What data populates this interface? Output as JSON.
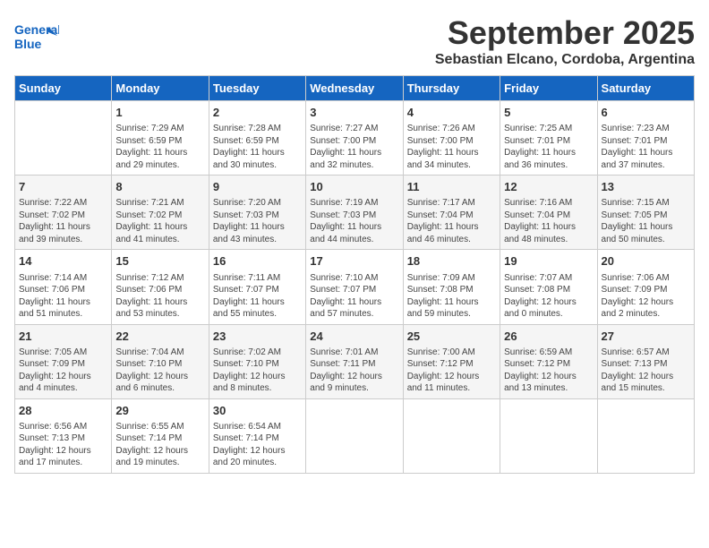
{
  "header": {
    "logo_line1": "General",
    "logo_line2": "Blue",
    "month": "September 2025",
    "location": "Sebastian Elcano, Cordoba, Argentina"
  },
  "days_of_week": [
    "Sunday",
    "Monday",
    "Tuesday",
    "Wednesday",
    "Thursday",
    "Friday",
    "Saturday"
  ],
  "weeks": [
    [
      {
        "day": "",
        "info": ""
      },
      {
        "day": "1",
        "info": "Sunrise: 7:29 AM\nSunset: 6:59 PM\nDaylight: 11 hours\nand 29 minutes."
      },
      {
        "day": "2",
        "info": "Sunrise: 7:28 AM\nSunset: 6:59 PM\nDaylight: 11 hours\nand 30 minutes."
      },
      {
        "day": "3",
        "info": "Sunrise: 7:27 AM\nSunset: 7:00 PM\nDaylight: 11 hours\nand 32 minutes."
      },
      {
        "day": "4",
        "info": "Sunrise: 7:26 AM\nSunset: 7:00 PM\nDaylight: 11 hours\nand 34 minutes."
      },
      {
        "day": "5",
        "info": "Sunrise: 7:25 AM\nSunset: 7:01 PM\nDaylight: 11 hours\nand 36 minutes."
      },
      {
        "day": "6",
        "info": "Sunrise: 7:23 AM\nSunset: 7:01 PM\nDaylight: 11 hours\nand 37 minutes."
      }
    ],
    [
      {
        "day": "7",
        "info": "Sunrise: 7:22 AM\nSunset: 7:02 PM\nDaylight: 11 hours\nand 39 minutes."
      },
      {
        "day": "8",
        "info": "Sunrise: 7:21 AM\nSunset: 7:02 PM\nDaylight: 11 hours\nand 41 minutes."
      },
      {
        "day": "9",
        "info": "Sunrise: 7:20 AM\nSunset: 7:03 PM\nDaylight: 11 hours\nand 43 minutes."
      },
      {
        "day": "10",
        "info": "Sunrise: 7:19 AM\nSunset: 7:03 PM\nDaylight: 11 hours\nand 44 minutes."
      },
      {
        "day": "11",
        "info": "Sunrise: 7:17 AM\nSunset: 7:04 PM\nDaylight: 11 hours\nand 46 minutes."
      },
      {
        "day": "12",
        "info": "Sunrise: 7:16 AM\nSunset: 7:04 PM\nDaylight: 11 hours\nand 48 minutes."
      },
      {
        "day": "13",
        "info": "Sunrise: 7:15 AM\nSunset: 7:05 PM\nDaylight: 11 hours\nand 50 minutes."
      }
    ],
    [
      {
        "day": "14",
        "info": "Sunrise: 7:14 AM\nSunset: 7:06 PM\nDaylight: 11 hours\nand 51 minutes."
      },
      {
        "day": "15",
        "info": "Sunrise: 7:12 AM\nSunset: 7:06 PM\nDaylight: 11 hours\nand 53 minutes."
      },
      {
        "day": "16",
        "info": "Sunrise: 7:11 AM\nSunset: 7:07 PM\nDaylight: 11 hours\nand 55 minutes."
      },
      {
        "day": "17",
        "info": "Sunrise: 7:10 AM\nSunset: 7:07 PM\nDaylight: 11 hours\nand 57 minutes."
      },
      {
        "day": "18",
        "info": "Sunrise: 7:09 AM\nSunset: 7:08 PM\nDaylight: 11 hours\nand 59 minutes."
      },
      {
        "day": "19",
        "info": "Sunrise: 7:07 AM\nSunset: 7:08 PM\nDaylight: 12 hours\nand 0 minutes."
      },
      {
        "day": "20",
        "info": "Sunrise: 7:06 AM\nSunset: 7:09 PM\nDaylight: 12 hours\nand 2 minutes."
      }
    ],
    [
      {
        "day": "21",
        "info": "Sunrise: 7:05 AM\nSunset: 7:09 PM\nDaylight: 12 hours\nand 4 minutes."
      },
      {
        "day": "22",
        "info": "Sunrise: 7:04 AM\nSunset: 7:10 PM\nDaylight: 12 hours\nand 6 minutes."
      },
      {
        "day": "23",
        "info": "Sunrise: 7:02 AM\nSunset: 7:10 PM\nDaylight: 12 hours\nand 8 minutes."
      },
      {
        "day": "24",
        "info": "Sunrise: 7:01 AM\nSunset: 7:11 PM\nDaylight: 12 hours\nand 9 minutes."
      },
      {
        "day": "25",
        "info": "Sunrise: 7:00 AM\nSunset: 7:12 PM\nDaylight: 12 hours\nand 11 minutes."
      },
      {
        "day": "26",
        "info": "Sunrise: 6:59 AM\nSunset: 7:12 PM\nDaylight: 12 hours\nand 13 minutes."
      },
      {
        "day": "27",
        "info": "Sunrise: 6:57 AM\nSunset: 7:13 PM\nDaylight: 12 hours\nand 15 minutes."
      }
    ],
    [
      {
        "day": "28",
        "info": "Sunrise: 6:56 AM\nSunset: 7:13 PM\nDaylight: 12 hours\nand 17 minutes."
      },
      {
        "day": "29",
        "info": "Sunrise: 6:55 AM\nSunset: 7:14 PM\nDaylight: 12 hours\nand 19 minutes."
      },
      {
        "day": "30",
        "info": "Sunrise: 6:54 AM\nSunset: 7:14 PM\nDaylight: 12 hours\nand 20 minutes."
      },
      {
        "day": "",
        "info": ""
      },
      {
        "day": "",
        "info": ""
      },
      {
        "day": "",
        "info": ""
      },
      {
        "day": "",
        "info": ""
      }
    ]
  ]
}
